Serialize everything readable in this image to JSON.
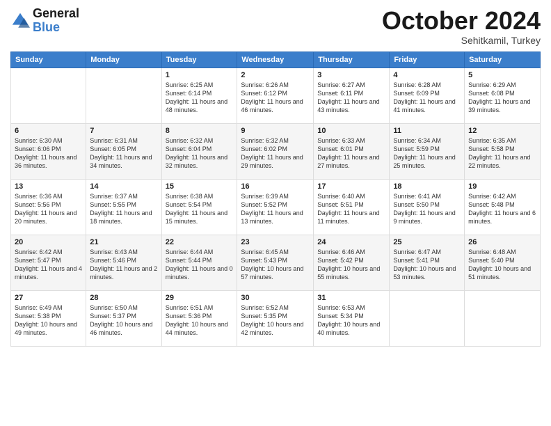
{
  "logo": {
    "text_general": "General",
    "text_blue": "Blue"
  },
  "header": {
    "month": "October 2024",
    "location": "Sehitkamil, Turkey"
  },
  "days_of_week": [
    "Sunday",
    "Monday",
    "Tuesday",
    "Wednesday",
    "Thursday",
    "Friday",
    "Saturday"
  ],
  "weeks": [
    [
      {
        "day": "",
        "sunrise": "",
        "sunset": "",
        "daylight": ""
      },
      {
        "day": "",
        "sunrise": "",
        "sunset": "",
        "daylight": ""
      },
      {
        "day": "1",
        "sunrise": "Sunrise: 6:25 AM",
        "sunset": "Sunset: 6:14 PM",
        "daylight": "Daylight: 11 hours and 48 minutes."
      },
      {
        "day": "2",
        "sunrise": "Sunrise: 6:26 AM",
        "sunset": "Sunset: 6:12 PM",
        "daylight": "Daylight: 11 hours and 46 minutes."
      },
      {
        "day": "3",
        "sunrise": "Sunrise: 6:27 AM",
        "sunset": "Sunset: 6:11 PM",
        "daylight": "Daylight: 11 hours and 43 minutes."
      },
      {
        "day": "4",
        "sunrise": "Sunrise: 6:28 AM",
        "sunset": "Sunset: 6:09 PM",
        "daylight": "Daylight: 11 hours and 41 minutes."
      },
      {
        "day": "5",
        "sunrise": "Sunrise: 6:29 AM",
        "sunset": "Sunset: 6:08 PM",
        "daylight": "Daylight: 11 hours and 39 minutes."
      }
    ],
    [
      {
        "day": "6",
        "sunrise": "Sunrise: 6:30 AM",
        "sunset": "Sunset: 6:06 PM",
        "daylight": "Daylight: 11 hours and 36 minutes."
      },
      {
        "day": "7",
        "sunrise": "Sunrise: 6:31 AM",
        "sunset": "Sunset: 6:05 PM",
        "daylight": "Daylight: 11 hours and 34 minutes."
      },
      {
        "day": "8",
        "sunrise": "Sunrise: 6:32 AM",
        "sunset": "Sunset: 6:04 PM",
        "daylight": "Daylight: 11 hours and 32 minutes."
      },
      {
        "day": "9",
        "sunrise": "Sunrise: 6:32 AM",
        "sunset": "Sunset: 6:02 PM",
        "daylight": "Daylight: 11 hours and 29 minutes."
      },
      {
        "day": "10",
        "sunrise": "Sunrise: 6:33 AM",
        "sunset": "Sunset: 6:01 PM",
        "daylight": "Daylight: 11 hours and 27 minutes."
      },
      {
        "day": "11",
        "sunrise": "Sunrise: 6:34 AM",
        "sunset": "Sunset: 5:59 PM",
        "daylight": "Daylight: 11 hours and 25 minutes."
      },
      {
        "day": "12",
        "sunrise": "Sunrise: 6:35 AM",
        "sunset": "Sunset: 5:58 PM",
        "daylight": "Daylight: 11 hours and 22 minutes."
      }
    ],
    [
      {
        "day": "13",
        "sunrise": "Sunrise: 6:36 AM",
        "sunset": "Sunset: 5:56 PM",
        "daylight": "Daylight: 11 hours and 20 minutes."
      },
      {
        "day": "14",
        "sunrise": "Sunrise: 6:37 AM",
        "sunset": "Sunset: 5:55 PM",
        "daylight": "Daylight: 11 hours and 18 minutes."
      },
      {
        "day": "15",
        "sunrise": "Sunrise: 6:38 AM",
        "sunset": "Sunset: 5:54 PM",
        "daylight": "Daylight: 11 hours and 15 minutes."
      },
      {
        "day": "16",
        "sunrise": "Sunrise: 6:39 AM",
        "sunset": "Sunset: 5:52 PM",
        "daylight": "Daylight: 11 hours and 13 minutes."
      },
      {
        "day": "17",
        "sunrise": "Sunrise: 6:40 AM",
        "sunset": "Sunset: 5:51 PM",
        "daylight": "Daylight: 11 hours and 11 minutes."
      },
      {
        "day": "18",
        "sunrise": "Sunrise: 6:41 AM",
        "sunset": "Sunset: 5:50 PM",
        "daylight": "Daylight: 11 hours and 9 minutes."
      },
      {
        "day": "19",
        "sunrise": "Sunrise: 6:42 AM",
        "sunset": "Sunset: 5:48 PM",
        "daylight": "Daylight: 11 hours and 6 minutes."
      }
    ],
    [
      {
        "day": "20",
        "sunrise": "Sunrise: 6:42 AM",
        "sunset": "Sunset: 5:47 PM",
        "daylight": "Daylight: 11 hours and 4 minutes."
      },
      {
        "day": "21",
        "sunrise": "Sunrise: 6:43 AM",
        "sunset": "Sunset: 5:46 PM",
        "daylight": "Daylight: 11 hours and 2 minutes."
      },
      {
        "day": "22",
        "sunrise": "Sunrise: 6:44 AM",
        "sunset": "Sunset: 5:44 PM",
        "daylight": "Daylight: 11 hours and 0 minutes."
      },
      {
        "day": "23",
        "sunrise": "Sunrise: 6:45 AM",
        "sunset": "Sunset: 5:43 PM",
        "daylight": "Daylight: 10 hours and 57 minutes."
      },
      {
        "day": "24",
        "sunrise": "Sunrise: 6:46 AM",
        "sunset": "Sunset: 5:42 PM",
        "daylight": "Daylight: 10 hours and 55 minutes."
      },
      {
        "day": "25",
        "sunrise": "Sunrise: 6:47 AM",
        "sunset": "Sunset: 5:41 PM",
        "daylight": "Daylight: 10 hours and 53 minutes."
      },
      {
        "day": "26",
        "sunrise": "Sunrise: 6:48 AM",
        "sunset": "Sunset: 5:40 PM",
        "daylight": "Daylight: 10 hours and 51 minutes."
      }
    ],
    [
      {
        "day": "27",
        "sunrise": "Sunrise: 6:49 AM",
        "sunset": "Sunset: 5:38 PM",
        "daylight": "Daylight: 10 hours and 49 minutes."
      },
      {
        "day": "28",
        "sunrise": "Sunrise: 6:50 AM",
        "sunset": "Sunset: 5:37 PM",
        "daylight": "Daylight: 10 hours and 46 minutes."
      },
      {
        "day": "29",
        "sunrise": "Sunrise: 6:51 AM",
        "sunset": "Sunset: 5:36 PM",
        "daylight": "Daylight: 10 hours and 44 minutes."
      },
      {
        "day": "30",
        "sunrise": "Sunrise: 6:52 AM",
        "sunset": "Sunset: 5:35 PM",
        "daylight": "Daylight: 10 hours and 42 minutes."
      },
      {
        "day": "31",
        "sunrise": "Sunrise: 6:53 AM",
        "sunset": "Sunset: 5:34 PM",
        "daylight": "Daylight: 10 hours and 40 minutes."
      },
      {
        "day": "",
        "sunrise": "",
        "sunset": "",
        "daylight": ""
      },
      {
        "day": "",
        "sunrise": "",
        "sunset": "",
        "daylight": ""
      }
    ]
  ]
}
